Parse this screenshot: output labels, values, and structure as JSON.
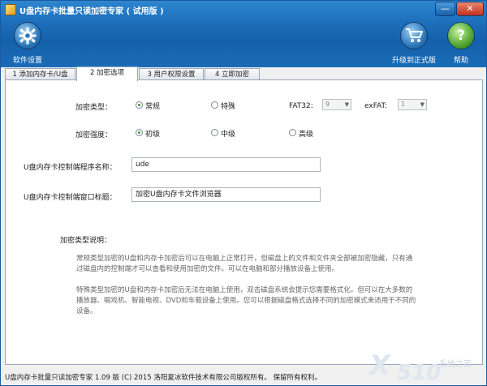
{
  "window": {
    "title": "U盘内存卡批量只读加密专家 ( 试用版 )",
    "minimize_glyph": "—",
    "close_glyph": "✕"
  },
  "toolbar": {
    "settings_label": "软件设置",
    "settings_icon": "gear-icon",
    "upgrade_label": "升级到正式版",
    "upgrade_icon": "cart-icon",
    "help_label": "帮助",
    "help_glyph": "?",
    "help_icon": "help-icon"
  },
  "tabs": [
    {
      "label": "1 添加内存卡/U盘",
      "active": false
    },
    {
      "label": "2 加密选项",
      "active": true
    },
    {
      "label": "3 用户权限设置",
      "active": false
    },
    {
      "label": "4 立即加密",
      "active": false
    }
  ],
  "form": {
    "encrypt_type_label": "加密类型：",
    "encrypt_type_options": [
      {
        "label": "常规",
        "selected": true
      },
      {
        "label": "特殊",
        "selected": false
      }
    ],
    "fat32_label": "FAT32:",
    "fat32_value": "9",
    "exfat_label": "exFAT:",
    "exfat_value": "1",
    "encrypt_strength_label": "加密强度：",
    "encrypt_strength_options": [
      {
        "label": "初级",
        "selected": true
      },
      {
        "label": "中级",
        "selected": false
      },
      {
        "label": "高级",
        "selected": false
      }
    ],
    "control_program_label": "U盘内存卡控制端程序名称：",
    "control_program_value": "ude",
    "control_window_label": "U盘内存卡控制端窗口标题：",
    "control_window_value": "加密U盘内存卡文件浏览器"
  },
  "description": {
    "title": "加密类型说明：",
    "para1": "常规类型加密的U盘和内存卡加密后可以在电脑上正常打开，但磁盘上的文件和文件夹全部被加密隐藏，只有通过磁盘内的控制端才可以查看和使用加密的文件。可以在电脑和部分播放设备上使用。",
    "para2": "特殊类型加密的U盘和内存卡加密后无法在电脑上使用，双击磁盘系统会提示您需要格式化。但可以在大多数的播放器、唱戏机、智能电视、DVD和车载设备上使用。您可以根据磁盘格式选择不同的加密模式来适用于不同的设备。"
  },
  "status": {
    "text": "U盘内存卡批量只读加密专家 1.09 版  (C)  2015 洛阳夏冰软件技术有限公司版权所有。  保留所有权利。"
  },
  "watermark": {
    "x": "X",
    "num": "510",
    "cn": "系统之家",
    "url": ".com"
  }
}
